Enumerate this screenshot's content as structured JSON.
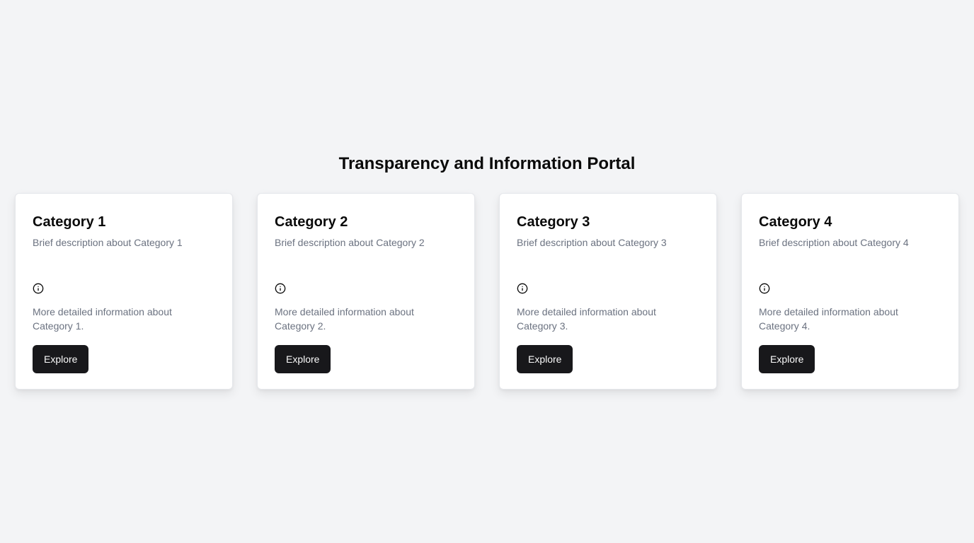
{
  "page": {
    "title": "Transparency and Information Portal"
  },
  "colors": {
    "background": "#f3f4f6",
    "card": "#ffffff",
    "button": "#18181b",
    "button_text": "#fafafa",
    "muted_text": "#6b7280"
  },
  "cards": [
    {
      "title": "Category 1",
      "description": "Brief description about Category 1",
      "icon": "info-icon",
      "detail": "More detailed information about Category 1.",
      "button_label": "Explore"
    },
    {
      "title": "Category 2",
      "description": "Brief description about Category 2",
      "icon": "info-icon",
      "detail": "More detailed information about Category 2.",
      "button_label": "Explore"
    },
    {
      "title": "Category 3",
      "description": "Brief description about Category 3",
      "icon": "info-icon",
      "detail": "More detailed information about Category 3.",
      "button_label": "Explore"
    },
    {
      "title": "Category 4",
      "description": "Brief description about Category 4",
      "icon": "info-icon",
      "detail": "More detailed information about Category 4.",
      "button_label": "Explore"
    }
  ]
}
